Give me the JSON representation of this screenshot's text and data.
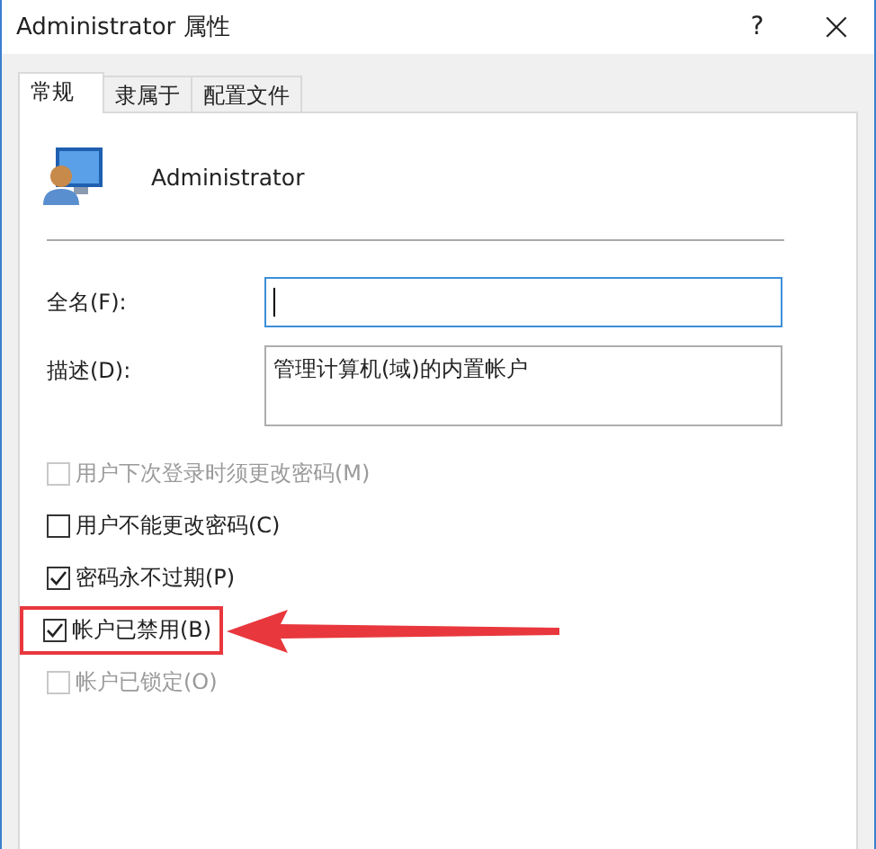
{
  "window": {
    "title": "Administrator 属性",
    "buttons": [
      {
        "kind": "help",
        "label": "?"
      },
      {
        "kind": "close",
        "label": "×"
      }
    ]
  },
  "tabs": [
    {
      "label": "常规",
      "selected": true
    },
    {
      "label": "隶属于",
      "selected": false
    },
    {
      "label": "配置文件",
      "selected": false
    }
  ],
  "user": {
    "name": "Administrator"
  },
  "fields": [
    {
      "label": "全名(F):",
      "kind": "line",
      "focused": true
    },
    {
      "label": "描述(D):",
      "kind": "multiline",
      "value": "管理计算机(域)的内置帐户",
      "focused": false
    }
  ],
  "checkboxes": [
    {
      "label": "用户下次登录时须更改密码(M)",
      "checked": false,
      "disabled": true,
      "highlighted": false
    },
    {
      "label": "用户不能更改密码(C)",
      "checked": false,
      "disabled": false,
      "highlighted": false
    },
    {
      "label": "密码永不过期(P)",
      "checked": true,
      "disabled": false,
      "highlighted": false
    },
    {
      "label": "帐户已禁用(B)",
      "checked": true,
      "disabled": false,
      "highlighted": true
    },
    {
      "label": "帐户已锁定(O)",
      "checked": false,
      "disabled": true,
      "highlighted": false
    }
  ]
}
